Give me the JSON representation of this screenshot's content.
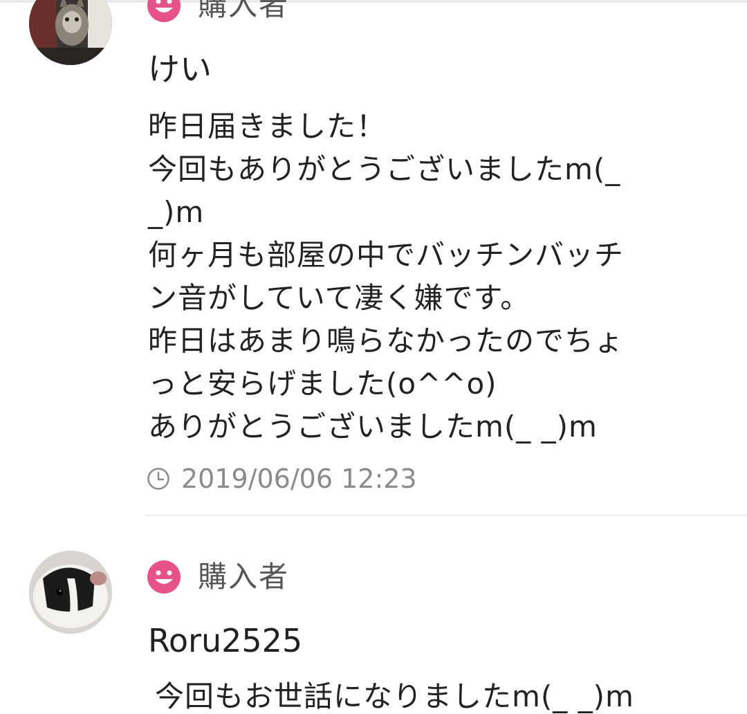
{
  "reviews": [
    {
      "badge_label": "購入者",
      "badge_icon": "smiley-face-icon",
      "avatar": "cat-avatar",
      "username": "けい",
      "comment": "昨日届きました！\n今回もありがとうございましたm(_\n_)m\n何ヶ月も部屋の中でバッチンバッチ\nン音がしていて凄く嫌です。\n昨日はあまり鳴らなかったのでちょ\nっと安らげました(o^^o)\nありがとうございましたm(_ _)m",
      "timestamp": "2019/06/06 12:23",
      "timestamp_icon": "clock-icon"
    },
    {
      "badge_label": "購入者",
      "badge_icon": "smiley-face-icon",
      "avatar": "guinea-pig-avatar",
      "username": "Roru2525",
      "comment": "今回もお世話になりましたm(_ _)m"
    }
  ],
  "colors": {
    "badge_pink": "#e8528a",
    "text": "#222222",
    "meta_gray": "#8a8a8a",
    "divider": "#eeeeee"
  }
}
